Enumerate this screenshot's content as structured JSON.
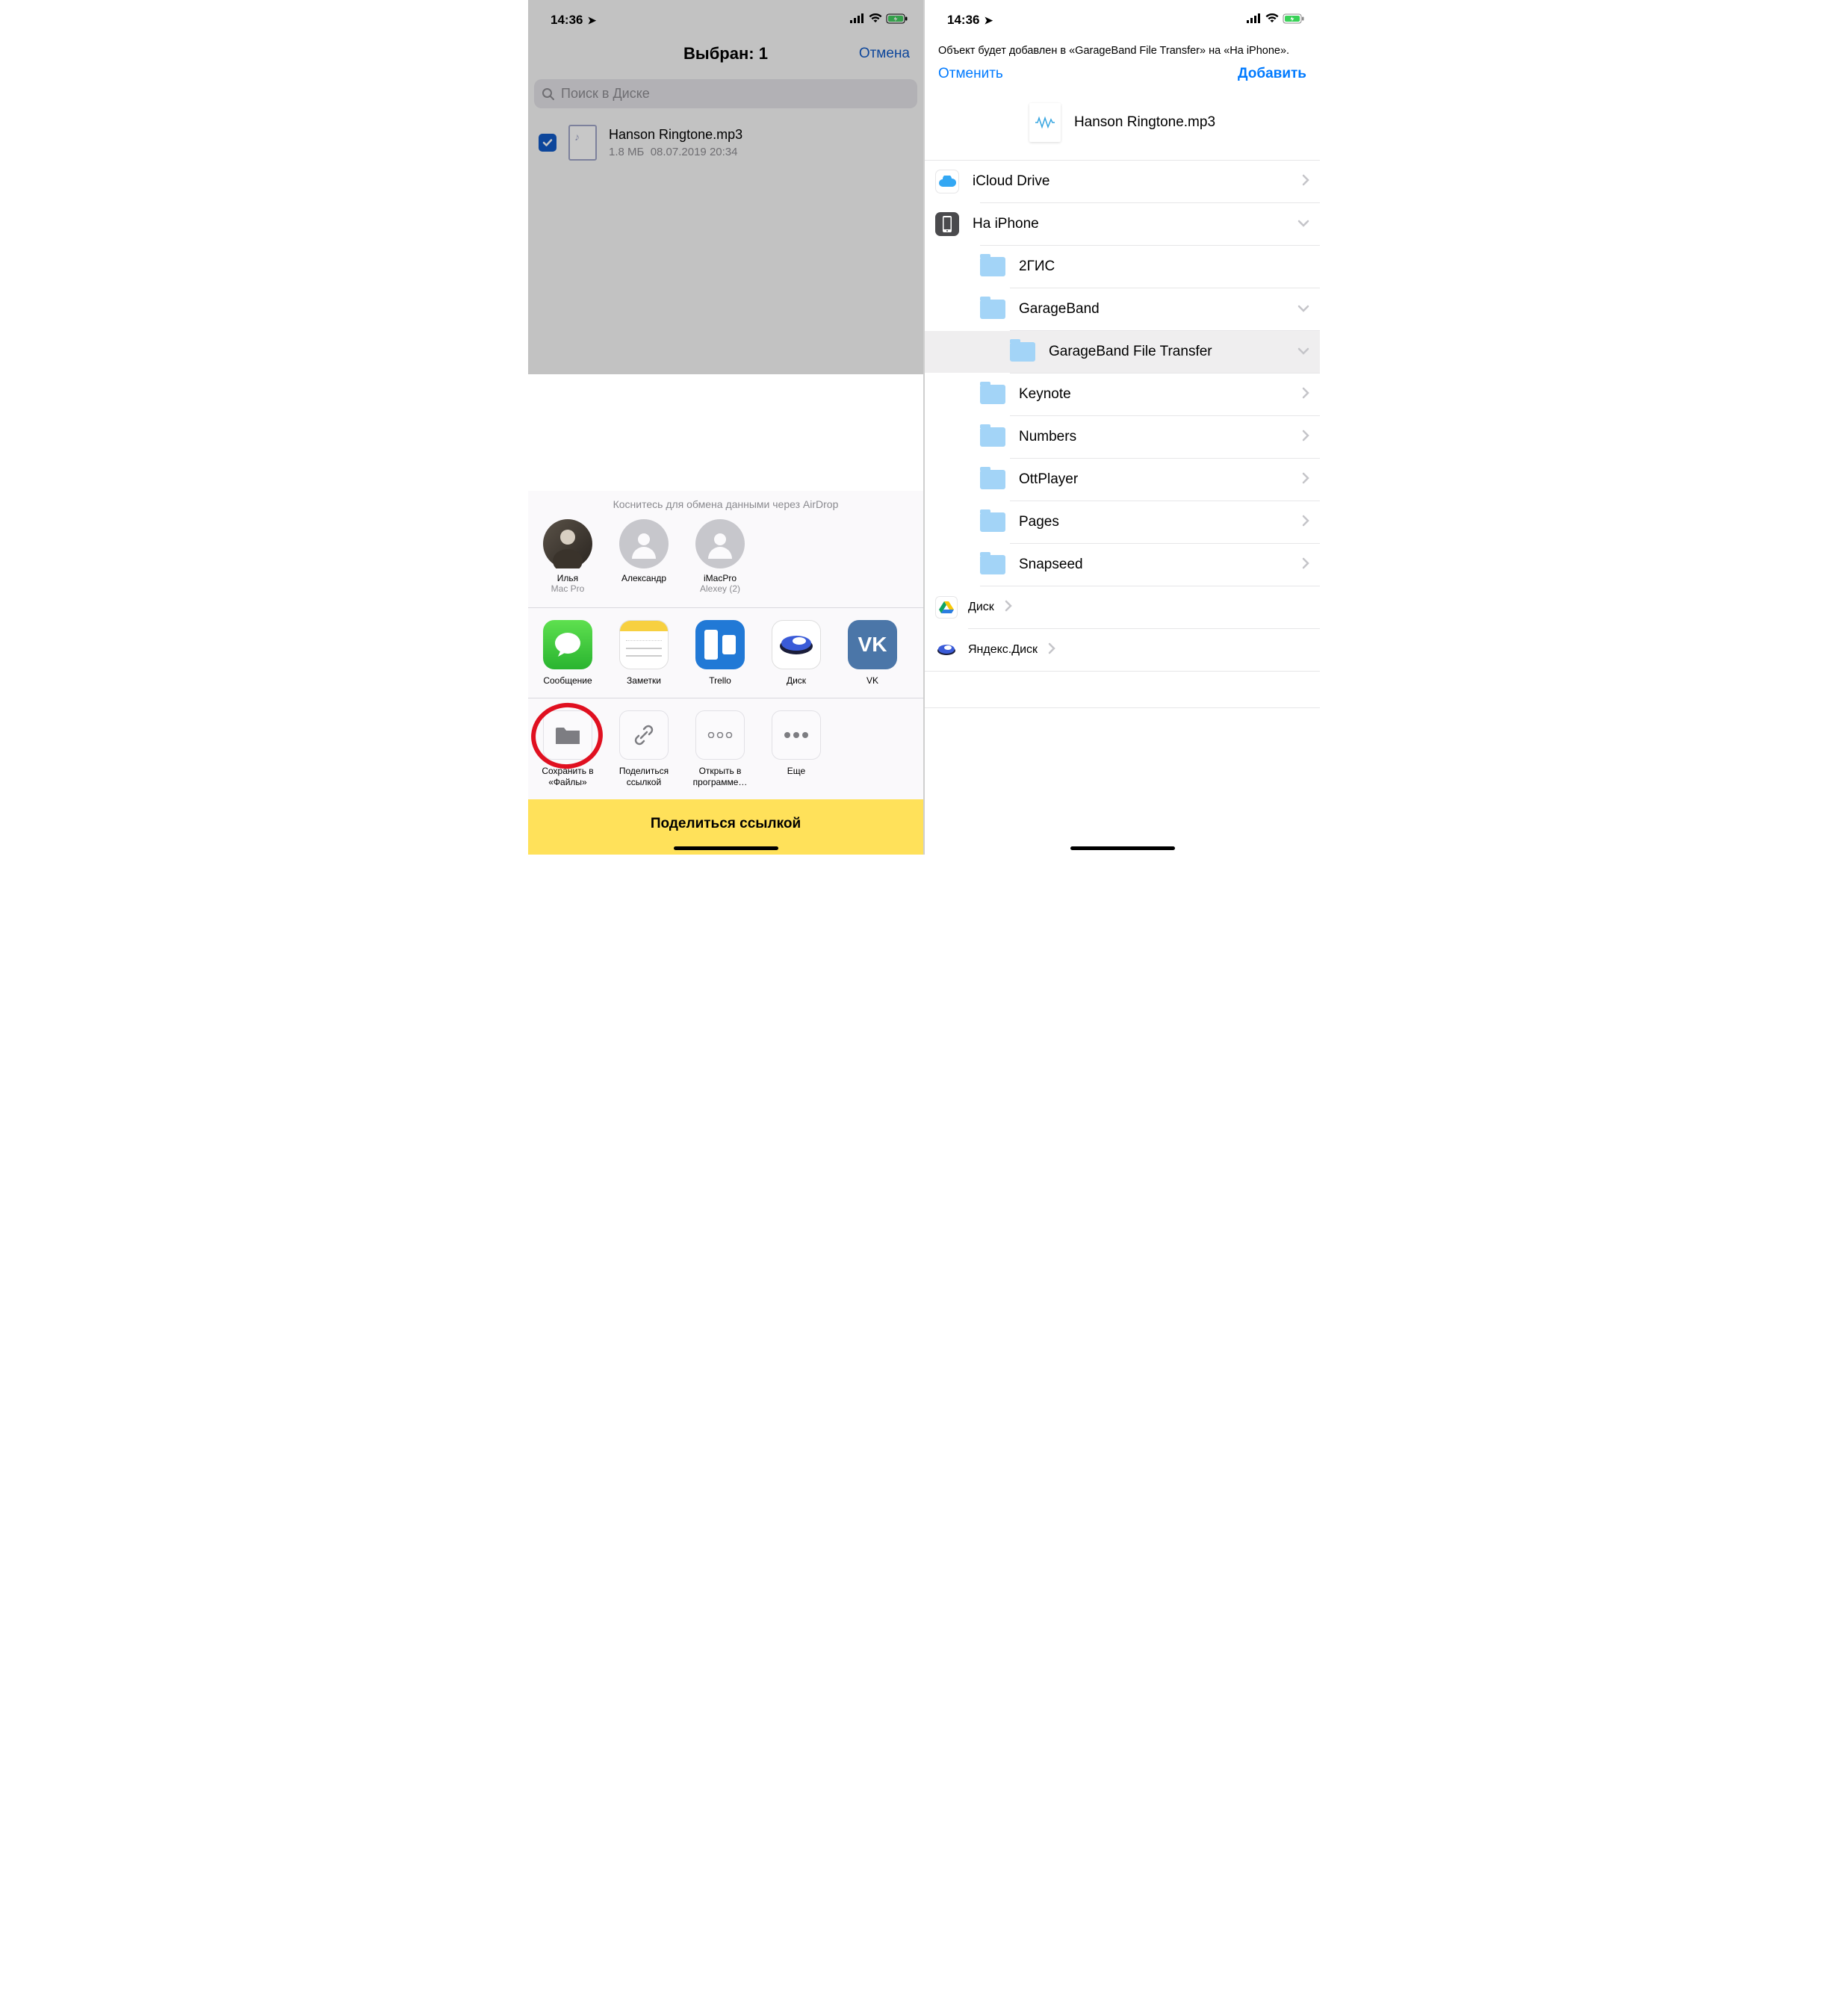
{
  "status": {
    "time": "14:36"
  },
  "left": {
    "title": "Выбран: 1",
    "cancel": "Отмена",
    "search_placeholder": "Поиск в Диске",
    "file": {
      "name": "Hanson Ringtone.mp3",
      "meta_size": "1.8 МБ",
      "meta_date": "08.07.2019 20:34"
    },
    "airdrop_hint": "Коснитесь для обмена данными через AirDrop",
    "contacts": [
      {
        "name": "Илья",
        "sub": "Mac Pro"
      },
      {
        "name": "Александр",
        "sub": ""
      },
      {
        "name": "iMacPro",
        "sub": "Alexey (2)"
      }
    ],
    "apps": [
      {
        "label": "Сообщение"
      },
      {
        "label": "Заметки"
      },
      {
        "label": "Trello"
      },
      {
        "label": "Диск"
      },
      {
        "label": "VK"
      }
    ],
    "actions": [
      {
        "label": "Сохранить в «Файлы»"
      },
      {
        "label": "Поделиться ссылкой"
      },
      {
        "label": "Открыть в программе…"
      },
      {
        "label": "Еще"
      }
    ],
    "share_link": "Поделиться ссылкой"
  },
  "right": {
    "message": "Объект будет добавлен в «GarageBand File Transfer» на «На iPhone».",
    "cancel": "Отменить",
    "add": "Добавить",
    "file_name": "Hanson Ringtone.mp3",
    "icloud": "iCloud Drive",
    "on_iphone": "На iPhone",
    "folders": [
      {
        "label": "2ГИС",
        "chev": false
      },
      {
        "label": "GarageBand",
        "chev": true,
        "expanded": true
      },
      {
        "label": "GarageBand File Transfer",
        "chev": true,
        "selected": true,
        "nested": true
      },
      {
        "label": "Keynote",
        "chev": false
      },
      {
        "label": "Numbers",
        "chev": false
      },
      {
        "label": "OttPlayer",
        "chev": false
      },
      {
        "label": "Pages",
        "chev": false
      },
      {
        "label": "Snapseed",
        "chev": false
      }
    ],
    "drives": [
      {
        "label": "Диск"
      },
      {
        "label": "Яндекс.Диск"
      }
    ]
  }
}
